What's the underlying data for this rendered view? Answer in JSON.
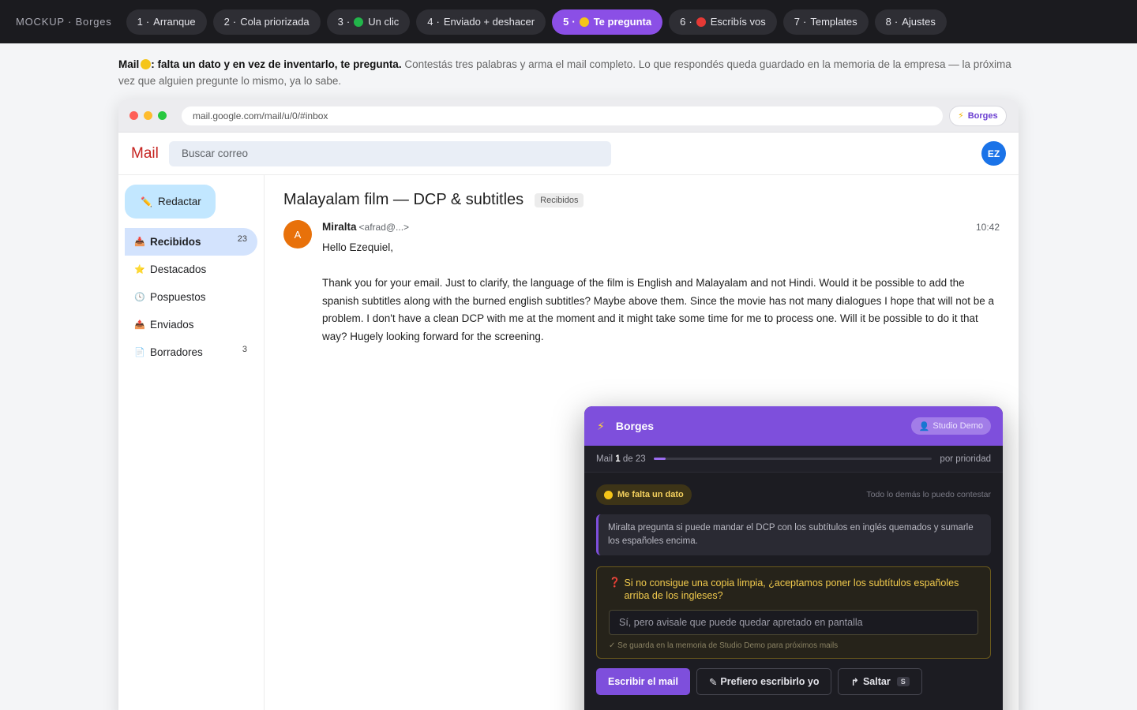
{
  "topbar": {
    "brand": "MOCKUP · Borges",
    "tabs": [
      {
        "num": "1",
        "label": "Arranque"
      },
      {
        "num": "2",
        "label": "Cola priorizada"
      },
      {
        "num": "3",
        "label": "Un clic",
        "dot": "green"
      },
      {
        "num": "4",
        "label": "Enviado + deshacer"
      },
      {
        "num": "5",
        "label": "Te pregunta",
        "dot": "yellow",
        "active": true
      },
      {
        "num": "6",
        "label": "Escribís vos",
        "dot": "red"
      },
      {
        "num": "7",
        "label": "Templates"
      },
      {
        "num": "8",
        "label": "Ajustes"
      }
    ]
  },
  "intro": {
    "lead": "Mail",
    "lead_rest": ": falta un dato y en vez de inventarlo, te pregunta.",
    "body": "Contestás tres palabras y arma el mail completo. Lo que respondés queda guardado en la memoria de la empresa — la próxima vez que alguien pregunte lo mismo, ya lo sabe."
  },
  "browser": {
    "url": "mail.google.com/mail/u/0/#inbox",
    "extension_label": "Borges"
  },
  "gmail": {
    "logo": "Mail",
    "search_placeholder": "Buscar correo",
    "avatar_initials": "EZ",
    "compose_label": "Redactar",
    "nav": [
      {
        "label": "Recibidos",
        "count": "23",
        "icon": "inbox-icon",
        "active": true
      },
      {
        "label": "Destacados",
        "count": "",
        "icon": "star-icon"
      },
      {
        "label": "Pospuestos",
        "count": "",
        "icon": "clock-icon"
      },
      {
        "label": "Enviados",
        "count": "",
        "icon": "sent-icon"
      },
      {
        "label": "Borradores",
        "count": "3",
        "icon": "draft-icon"
      }
    ],
    "email": {
      "subject": "Malayalam film — DCP & subtitles",
      "label": "Recibidos",
      "sender_initial": "A",
      "sender_name": "Miralta",
      "sender_email": "<afrad@...>",
      "time": "10:42",
      "body": "Hello Ezequiel,\n\nThank you for your email. Just to clarify, the language of the film is English and Malayalam and not Hindi. Would it be possible to add the spanish subtitles along with the burned english subtitles? Maybe above them. Since the movie has not many dialogues I hope that will not be a problem. I don't have a clean DCP with me at the moment and it might take some time for me to process one. Will it be possible to do it that way? Hugely looking forward for the screening."
    }
  },
  "panel": {
    "title": "Borges",
    "workspace": "Studio Demo",
    "progress": {
      "prefix": "Mail",
      "current": "1",
      "middle": "de",
      "total": "23",
      "fraction": 0.043,
      "sort_label": "por prioridad"
    },
    "badge": "Me falta un dato",
    "status_note": "Todo lo demás lo puedo contestar",
    "summary": "Miralta pregunta si puede mandar el DCP con los subtítulos en inglés quemados y sumarle los españoles encima.",
    "question": "Si no consigue una copia limpia, ¿aceptamos poner los subtítulos españoles arriba de los ingleses?",
    "answer_value": "Sí, pero avisale que puede quedar apretado en pantalla",
    "memory_note": "✓ Se guarda en la memoria de Studio Demo para próximos mails",
    "buttons": {
      "write": "Escribir el mail",
      "self_write": "Prefiero escribirlo yo",
      "skip": "Saltar",
      "skip_key": "S"
    }
  },
  "colors": {
    "accent": "#7e4fdc",
    "active_tab": "#8b4fe6",
    "gmail_logo": "#c5221f"
  }
}
